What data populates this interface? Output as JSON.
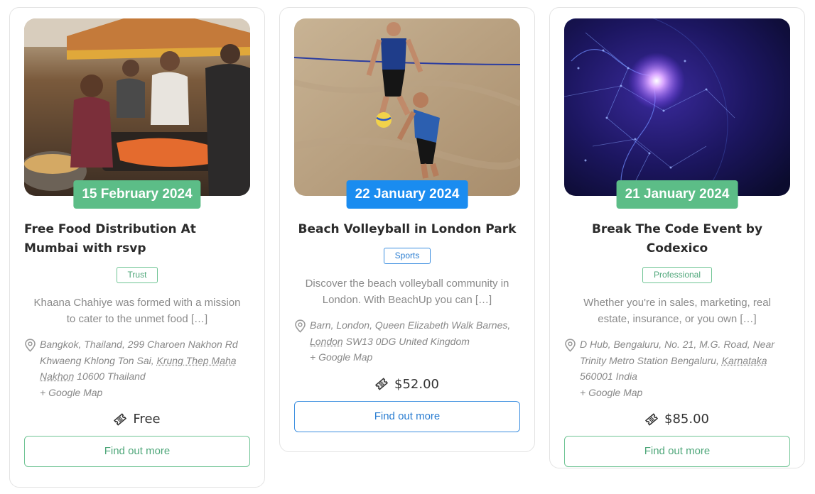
{
  "events": [
    {
      "date": "15 February 2024",
      "title": "Free Food Distribution At Mumbai with rsvp",
      "category": "Trust",
      "excerpt": "Khaana Chahiye was formed with a mission to cater to the unmet food […]",
      "location_line1": "Bangkok, Thailand, 299 Charoen Nakhon Rd Khwaeng Khlong Ton Sai, ",
      "location_city": "Krung Thep Maha Nakhon",
      "location_line2": " 10600 Thailand",
      "google_map": "+ Google Map",
      "price": "Free",
      "cta": "Find out more",
      "image_icon": "food-market-photo",
      "accent": "#5cbd87"
    },
    {
      "date": "22 January 2024",
      "title": "Beach Volleyball in London Park",
      "category": "Sports",
      "excerpt": "Discover the beach volleyball community in London. With BeachUp you can […]",
      "location_line1": "Barn, London, Queen Elizabeth Walk Barnes, ",
      "location_city": "London",
      "location_line2": " SW13 0DG United Kingdom",
      "google_map": "+ Google Map",
      "price": "$52.00",
      "cta": "Find out more",
      "image_icon": "beach-volleyball-photo",
      "accent": "#1a8cf0"
    },
    {
      "date": "21 January 2024",
      "title": "Break The Code Event by Codexico",
      "category": "Professional",
      "excerpt": "Whether you're in sales, marketing, real estate, insurance, or you own […]",
      "location_line1": "D Hub, Bengaluru, No. 21, M.G. Road, Near Trinity Metro Station Bengaluru, ",
      "location_city": "Karnataka",
      "location_line2": " 560001 India",
      "google_map": "+ Google Map",
      "price": "$85.00",
      "cta": "Find out more",
      "image_icon": "digital-globe-photo",
      "accent": "#5cbd87"
    }
  ],
  "icons": {
    "location": "map-pin-icon",
    "price": "ticket-icon"
  }
}
